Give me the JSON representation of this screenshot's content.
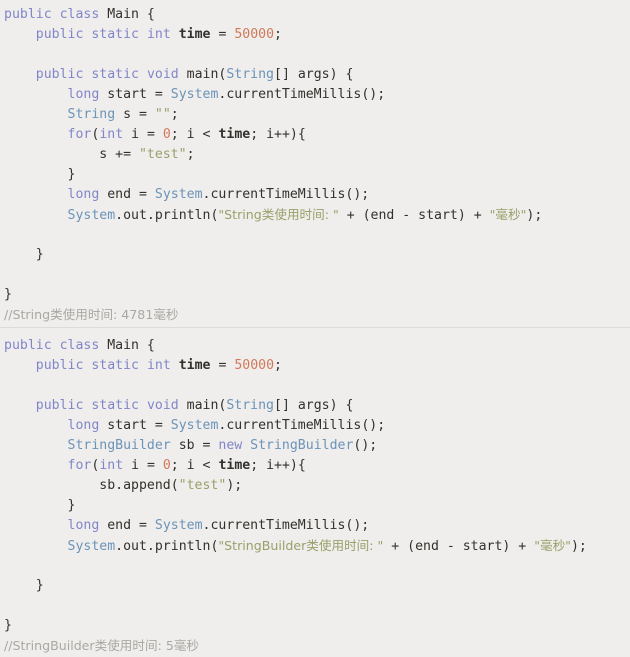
{
  "editor": {
    "background": "#efeeec",
    "divider_color": "#dcdbd8",
    "colors": {
      "keyword": "#8186c9",
      "type": "#6c93b8",
      "number": "#d0795a",
      "string": "#9aa06a",
      "field": "#33312e",
      "plain": "#33312e",
      "comment": "#a9a8a4"
    }
  },
  "blocks": [
    {
      "id": "string-concat-example",
      "language": "Java",
      "lines": [
        [
          {
            "t": "public",
            "c": "kw"
          },
          {
            "t": " ",
            "c": "pln"
          },
          {
            "t": "class",
            "c": "kw"
          },
          {
            "t": " Main {",
            "c": "pln"
          }
        ],
        [
          {
            "t": "    ",
            "c": "pln"
          },
          {
            "t": "public",
            "c": "kw"
          },
          {
            "t": " ",
            "c": "pln"
          },
          {
            "t": "static",
            "c": "kw"
          },
          {
            "t": " ",
            "c": "pln"
          },
          {
            "t": "int",
            "c": "kw"
          },
          {
            "t": " ",
            "c": "pln"
          },
          {
            "t": "time",
            "c": "fld"
          },
          {
            "t": " = ",
            "c": "pln"
          },
          {
            "t": "50000",
            "c": "num"
          },
          {
            "t": ";",
            "c": "pln"
          }
        ],
        [],
        [
          {
            "t": "    ",
            "c": "pln"
          },
          {
            "t": "public",
            "c": "kw"
          },
          {
            "t": " ",
            "c": "pln"
          },
          {
            "t": "static",
            "c": "kw"
          },
          {
            "t": " ",
            "c": "pln"
          },
          {
            "t": "void",
            "c": "kw"
          },
          {
            "t": " main(",
            "c": "pln"
          },
          {
            "t": "String",
            "c": "typ"
          },
          {
            "t": "[] args) {",
            "c": "pln"
          }
        ],
        [
          {
            "t": "        ",
            "c": "pln"
          },
          {
            "t": "long",
            "c": "kw"
          },
          {
            "t": " start = ",
            "c": "pln"
          },
          {
            "t": "System",
            "c": "typ"
          },
          {
            "t": ".currentTimeMillis();",
            "c": "pln"
          }
        ],
        [
          {
            "t": "        ",
            "c": "pln"
          },
          {
            "t": "String",
            "c": "typ"
          },
          {
            "t": " s = ",
            "c": "pln"
          },
          {
            "t": "\"\"",
            "c": "str"
          },
          {
            "t": ";",
            "c": "pln"
          }
        ],
        [
          {
            "t": "        ",
            "c": "pln"
          },
          {
            "t": "for",
            "c": "kw"
          },
          {
            "t": "(",
            "c": "pln"
          },
          {
            "t": "int",
            "c": "kw"
          },
          {
            "t": " i = ",
            "c": "pln"
          },
          {
            "t": "0",
            "c": "num"
          },
          {
            "t": "; i < ",
            "c": "pln"
          },
          {
            "t": "time",
            "c": "fld"
          },
          {
            "t": "; i++){",
            "c": "pln"
          }
        ],
        [
          {
            "t": "            s += ",
            "c": "pln"
          },
          {
            "t": "\"test\"",
            "c": "str"
          },
          {
            "t": ";",
            "c": "pln"
          }
        ],
        [
          {
            "t": "        }",
            "c": "pln"
          }
        ],
        [
          {
            "t": "        ",
            "c": "pln"
          },
          {
            "t": "long",
            "c": "kw"
          },
          {
            "t": " end = ",
            "c": "pln"
          },
          {
            "t": "System",
            "c": "typ"
          },
          {
            "t": ".currentTimeMillis();",
            "c": "pln"
          }
        ],
        [
          {
            "t": "        ",
            "c": "pln"
          },
          {
            "t": "System",
            "c": "typ"
          },
          {
            "t": ".out.println(",
            "c": "pln"
          },
          {
            "t": "\"String类使用时间: \"",
            "c": "str"
          },
          {
            "t": " + (end - start) + ",
            "c": "pln"
          },
          {
            "t": "\"毫秒\"",
            "c": "str"
          },
          {
            "t": ");",
            "c": "pln"
          }
        ],
        [],
        [
          {
            "t": "    }",
            "c": "pln"
          }
        ],
        [],
        [
          {
            "t": "}",
            "c": "pln"
          }
        ],
        [
          {
            "t": "//String类使用时间: 4781毫秒",
            "c": "cmt"
          }
        ]
      ]
    },
    {
      "id": "stringbuilder-example",
      "language": "Java",
      "lines": [
        [
          {
            "t": "public",
            "c": "kw"
          },
          {
            "t": " ",
            "c": "pln"
          },
          {
            "t": "class",
            "c": "kw"
          },
          {
            "t": " Main {",
            "c": "pln"
          }
        ],
        [
          {
            "t": "    ",
            "c": "pln"
          },
          {
            "t": "public",
            "c": "kw"
          },
          {
            "t": " ",
            "c": "pln"
          },
          {
            "t": "static",
            "c": "kw"
          },
          {
            "t": " ",
            "c": "pln"
          },
          {
            "t": "int",
            "c": "kw"
          },
          {
            "t": " ",
            "c": "pln"
          },
          {
            "t": "time",
            "c": "fld"
          },
          {
            "t": " = ",
            "c": "pln"
          },
          {
            "t": "50000",
            "c": "num"
          },
          {
            "t": ";",
            "c": "pln"
          }
        ],
        [],
        [
          {
            "t": "    ",
            "c": "pln"
          },
          {
            "t": "public",
            "c": "kw"
          },
          {
            "t": " ",
            "c": "pln"
          },
          {
            "t": "static",
            "c": "kw"
          },
          {
            "t": " ",
            "c": "pln"
          },
          {
            "t": "void",
            "c": "kw"
          },
          {
            "t": " main(",
            "c": "pln"
          },
          {
            "t": "String",
            "c": "typ"
          },
          {
            "t": "[] args) {",
            "c": "pln"
          }
        ],
        [
          {
            "t": "        ",
            "c": "pln"
          },
          {
            "t": "long",
            "c": "kw"
          },
          {
            "t": " start = ",
            "c": "pln"
          },
          {
            "t": "System",
            "c": "typ"
          },
          {
            "t": ".currentTimeMillis();",
            "c": "pln"
          }
        ],
        [
          {
            "t": "        ",
            "c": "pln"
          },
          {
            "t": "StringBuilder",
            "c": "typ"
          },
          {
            "t": " sb = ",
            "c": "pln"
          },
          {
            "t": "new",
            "c": "kw"
          },
          {
            "t": " ",
            "c": "pln"
          },
          {
            "t": "StringBuilder",
            "c": "typ"
          },
          {
            "t": "();",
            "c": "pln"
          }
        ],
        [
          {
            "t": "        ",
            "c": "pln"
          },
          {
            "t": "for",
            "c": "kw"
          },
          {
            "t": "(",
            "c": "pln"
          },
          {
            "t": "int",
            "c": "kw"
          },
          {
            "t": " i = ",
            "c": "pln"
          },
          {
            "t": "0",
            "c": "num"
          },
          {
            "t": "; i < ",
            "c": "pln"
          },
          {
            "t": "time",
            "c": "fld"
          },
          {
            "t": "; i++){",
            "c": "pln"
          }
        ],
        [
          {
            "t": "            sb.append(",
            "c": "pln"
          },
          {
            "t": "\"test\"",
            "c": "str"
          },
          {
            "t": ");",
            "c": "pln"
          }
        ],
        [
          {
            "t": "        }",
            "c": "pln"
          }
        ],
        [
          {
            "t": "        ",
            "c": "pln"
          },
          {
            "t": "long",
            "c": "kw"
          },
          {
            "t": " end = ",
            "c": "pln"
          },
          {
            "t": "System",
            "c": "typ"
          },
          {
            "t": ".currentTimeMillis();",
            "c": "pln"
          }
        ],
        [
          {
            "t": "        ",
            "c": "pln"
          },
          {
            "t": "System",
            "c": "typ"
          },
          {
            "t": ".out.println(",
            "c": "pln"
          },
          {
            "t": "\"StringBuilder类使用时间: \"",
            "c": "str"
          },
          {
            "t": " + (end - start) + ",
            "c": "pln"
          },
          {
            "t": "\"毫秒\"",
            "c": "str"
          },
          {
            "t": ");",
            "c": "pln"
          }
        ],
        [],
        [
          {
            "t": "    }",
            "c": "pln"
          }
        ],
        [],
        [
          {
            "t": "}",
            "c": "pln"
          }
        ],
        [
          {
            "t": "//StringBuilder类使用时间: 5毫秒",
            "c": "cmt"
          }
        ]
      ]
    }
  ]
}
